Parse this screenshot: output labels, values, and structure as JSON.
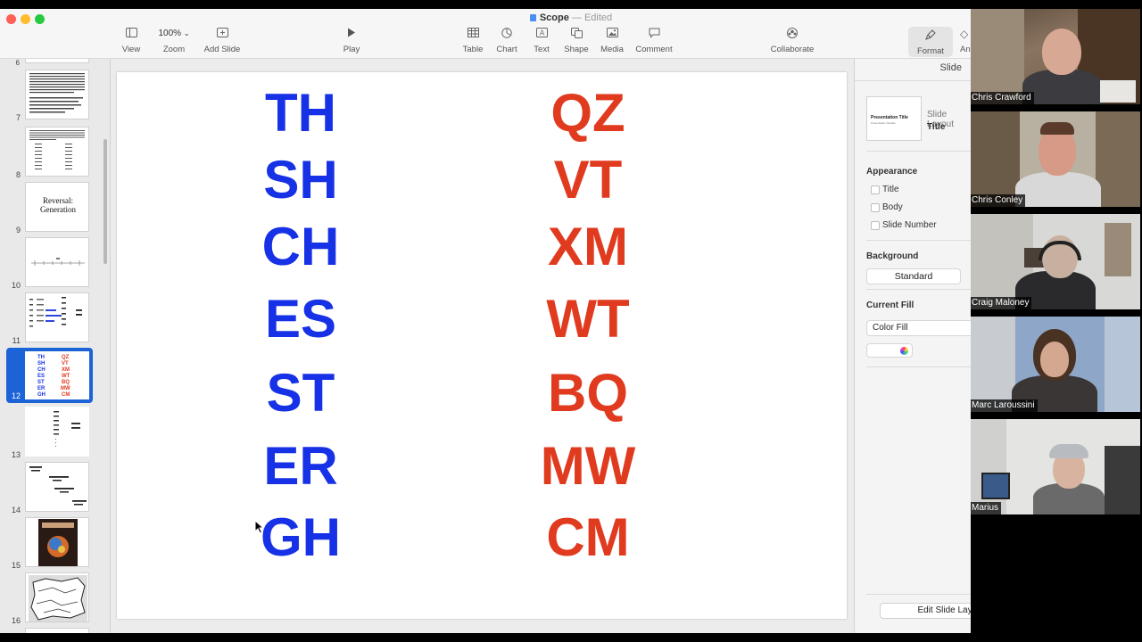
{
  "window": {
    "title": "Scope",
    "status": "— Edited"
  },
  "toolbar": {
    "view": "View",
    "zoom_value": "100%",
    "zoom": "Zoom",
    "add_slide": "Add Slide",
    "play": "Play",
    "table": "Table",
    "chart": "Chart",
    "text": "Text",
    "shape": "Shape",
    "media": "Media",
    "comment": "Comment",
    "collaborate": "Collaborate",
    "format": "Format",
    "animate_partial": "An"
  },
  "navigator": {
    "slides": [
      {
        "num": "7"
      },
      {
        "num": "8"
      },
      {
        "num": "9",
        "text": "Reversal: Generation"
      },
      {
        "num": "10"
      },
      {
        "num": "11"
      },
      {
        "num": "12",
        "selected": true
      },
      {
        "num": "13"
      },
      {
        "num": "14"
      },
      {
        "num": "15"
      },
      {
        "num": "16"
      }
    ]
  },
  "slide": {
    "left_column": [
      "TH",
      "SH",
      "CH",
      "ES",
      "ST",
      "ER",
      "GH"
    ],
    "right_column": [
      "QZ",
      "VT",
      "XM",
      "WT",
      "BQ",
      "MW",
      "CM"
    ],
    "left_color": "#1631e6",
    "right_color": "#e03a1f"
  },
  "inspector": {
    "tab": "Slide",
    "layout_heading": "Slide Layout",
    "layout_name": "Title",
    "layout_thumb_title": "Presentation Title",
    "appearance": "Appearance",
    "opt_title": "Title",
    "opt_body": "Body",
    "opt_slide_number": "Slide Number",
    "background": "Background",
    "background_value": "Standard",
    "current_fill": "Current Fill",
    "fill_type": "Color Fill",
    "edit_layout": "Edit Slide Layout"
  },
  "participants": [
    {
      "name": "Chris Crawford"
    },
    {
      "name": "Chris Conley"
    },
    {
      "name": "Craig Maloney"
    },
    {
      "name": "Marc Laroussini"
    },
    {
      "name": "Marius"
    }
  ]
}
